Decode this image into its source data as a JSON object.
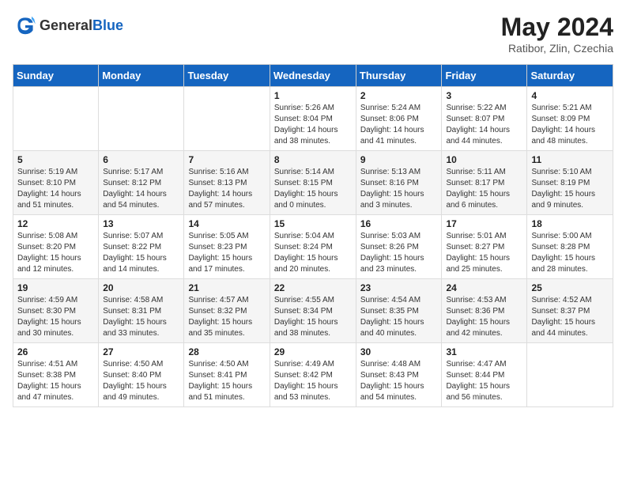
{
  "logo": {
    "general": "General",
    "blue": "Blue"
  },
  "header": {
    "month_year": "May 2024",
    "location": "Ratibor, Zlin, Czechia"
  },
  "weekdays": [
    "Sunday",
    "Monday",
    "Tuesday",
    "Wednesday",
    "Thursday",
    "Friday",
    "Saturday"
  ],
  "weeks": [
    [
      {
        "day": "",
        "info": ""
      },
      {
        "day": "",
        "info": ""
      },
      {
        "day": "",
        "info": ""
      },
      {
        "day": "1",
        "info": "Sunrise: 5:26 AM\nSunset: 8:04 PM\nDaylight: 14 hours and 38 minutes."
      },
      {
        "day": "2",
        "info": "Sunrise: 5:24 AM\nSunset: 8:06 PM\nDaylight: 14 hours and 41 minutes."
      },
      {
        "day": "3",
        "info": "Sunrise: 5:22 AM\nSunset: 8:07 PM\nDaylight: 14 hours and 44 minutes."
      },
      {
        "day": "4",
        "info": "Sunrise: 5:21 AM\nSunset: 8:09 PM\nDaylight: 14 hours and 48 minutes."
      }
    ],
    [
      {
        "day": "5",
        "info": "Sunrise: 5:19 AM\nSunset: 8:10 PM\nDaylight: 14 hours and 51 minutes."
      },
      {
        "day": "6",
        "info": "Sunrise: 5:17 AM\nSunset: 8:12 PM\nDaylight: 14 hours and 54 minutes."
      },
      {
        "day": "7",
        "info": "Sunrise: 5:16 AM\nSunset: 8:13 PM\nDaylight: 14 hours and 57 minutes."
      },
      {
        "day": "8",
        "info": "Sunrise: 5:14 AM\nSunset: 8:15 PM\nDaylight: 15 hours and 0 minutes."
      },
      {
        "day": "9",
        "info": "Sunrise: 5:13 AM\nSunset: 8:16 PM\nDaylight: 15 hours and 3 minutes."
      },
      {
        "day": "10",
        "info": "Sunrise: 5:11 AM\nSunset: 8:17 PM\nDaylight: 15 hours and 6 minutes."
      },
      {
        "day": "11",
        "info": "Sunrise: 5:10 AM\nSunset: 8:19 PM\nDaylight: 15 hours and 9 minutes."
      }
    ],
    [
      {
        "day": "12",
        "info": "Sunrise: 5:08 AM\nSunset: 8:20 PM\nDaylight: 15 hours and 12 minutes."
      },
      {
        "day": "13",
        "info": "Sunrise: 5:07 AM\nSunset: 8:22 PM\nDaylight: 15 hours and 14 minutes."
      },
      {
        "day": "14",
        "info": "Sunrise: 5:05 AM\nSunset: 8:23 PM\nDaylight: 15 hours and 17 minutes."
      },
      {
        "day": "15",
        "info": "Sunrise: 5:04 AM\nSunset: 8:24 PM\nDaylight: 15 hours and 20 minutes."
      },
      {
        "day": "16",
        "info": "Sunrise: 5:03 AM\nSunset: 8:26 PM\nDaylight: 15 hours and 23 minutes."
      },
      {
        "day": "17",
        "info": "Sunrise: 5:01 AM\nSunset: 8:27 PM\nDaylight: 15 hours and 25 minutes."
      },
      {
        "day": "18",
        "info": "Sunrise: 5:00 AM\nSunset: 8:28 PM\nDaylight: 15 hours and 28 minutes."
      }
    ],
    [
      {
        "day": "19",
        "info": "Sunrise: 4:59 AM\nSunset: 8:30 PM\nDaylight: 15 hours and 30 minutes."
      },
      {
        "day": "20",
        "info": "Sunrise: 4:58 AM\nSunset: 8:31 PM\nDaylight: 15 hours and 33 minutes."
      },
      {
        "day": "21",
        "info": "Sunrise: 4:57 AM\nSunset: 8:32 PM\nDaylight: 15 hours and 35 minutes."
      },
      {
        "day": "22",
        "info": "Sunrise: 4:55 AM\nSunset: 8:34 PM\nDaylight: 15 hours and 38 minutes."
      },
      {
        "day": "23",
        "info": "Sunrise: 4:54 AM\nSunset: 8:35 PM\nDaylight: 15 hours and 40 minutes."
      },
      {
        "day": "24",
        "info": "Sunrise: 4:53 AM\nSunset: 8:36 PM\nDaylight: 15 hours and 42 minutes."
      },
      {
        "day": "25",
        "info": "Sunrise: 4:52 AM\nSunset: 8:37 PM\nDaylight: 15 hours and 44 minutes."
      }
    ],
    [
      {
        "day": "26",
        "info": "Sunrise: 4:51 AM\nSunset: 8:38 PM\nDaylight: 15 hours and 47 minutes."
      },
      {
        "day": "27",
        "info": "Sunrise: 4:50 AM\nSunset: 8:40 PM\nDaylight: 15 hours and 49 minutes."
      },
      {
        "day": "28",
        "info": "Sunrise: 4:50 AM\nSunset: 8:41 PM\nDaylight: 15 hours and 51 minutes."
      },
      {
        "day": "29",
        "info": "Sunrise: 4:49 AM\nSunset: 8:42 PM\nDaylight: 15 hours and 53 minutes."
      },
      {
        "day": "30",
        "info": "Sunrise: 4:48 AM\nSunset: 8:43 PM\nDaylight: 15 hours and 54 minutes."
      },
      {
        "day": "31",
        "info": "Sunrise: 4:47 AM\nSunset: 8:44 PM\nDaylight: 15 hours and 56 minutes."
      },
      {
        "day": "",
        "info": ""
      }
    ]
  ]
}
